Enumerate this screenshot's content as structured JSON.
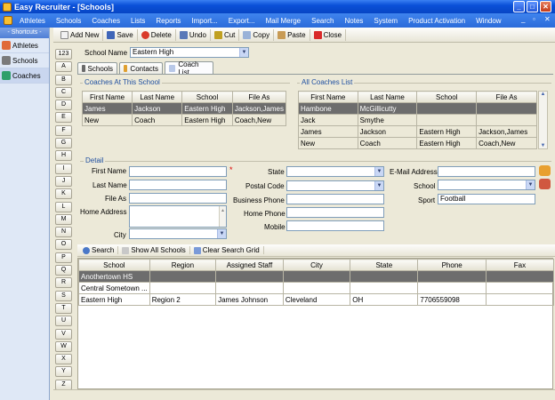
{
  "app": {
    "title": "Easy Recruiter - [Schools]"
  },
  "menu": [
    "Athletes",
    "Schools",
    "Coaches",
    "Lists",
    "Reports",
    "Import...",
    "Export...",
    "Mail Merge",
    "Search",
    "Notes",
    "System",
    "Product Activation",
    "Window"
  ],
  "shortcuts": {
    "header": "- Shortcuts -",
    "items": [
      "Athletes",
      "Schools",
      "Coaches"
    ]
  },
  "toolbar": {
    "add_new": "Add New",
    "save": "Save",
    "delete": "Delete",
    "undo": "Undo",
    "cut": "Cut",
    "copy": "Copy",
    "paste": "Paste",
    "close": "Close"
  },
  "alpha": [
    "123",
    "A",
    "B",
    "C",
    "D",
    "E",
    "F",
    "G",
    "H",
    "I",
    "J",
    "K",
    "L",
    "M",
    "N",
    "O",
    "P",
    "Q",
    "R",
    "S",
    "T",
    "U",
    "V",
    "W",
    "X",
    "Y",
    "Z"
  ],
  "school": {
    "label": "School Name",
    "value": "Eastern High"
  },
  "tabs": [
    "Schools",
    "Contacts",
    "Coach List"
  ],
  "coaches_at_school": {
    "title": "Coaches At This School",
    "headers": [
      "First Name",
      "Last Name",
      "School",
      "File As"
    ],
    "rows": [
      [
        "James",
        "Jackson",
        "Eastern High",
        "Jackson,James"
      ],
      [
        "New",
        "Coach",
        "Eastern High",
        "Coach,New"
      ]
    ]
  },
  "all_coaches": {
    "title": "All Coaches List",
    "headers": [
      "First Name",
      "Last Name",
      "School",
      "File As"
    ],
    "rows": [
      [
        "Hambone",
        "McGillicutty",
        "",
        ""
      ],
      [
        "Jack",
        "Smythe",
        "",
        ""
      ],
      [
        "James",
        "Jackson",
        "Eastern High",
        "Jackson,James"
      ],
      [
        "New",
        "Coach",
        "Eastern High",
        "Coach,New"
      ]
    ]
  },
  "detail": {
    "title": "Detail",
    "first_name": "First Name",
    "last_name": "Last Name",
    "file_as": "File As",
    "home_address": "Home Address",
    "city": "City",
    "state": "State",
    "postal_code": "Postal Code",
    "business_phone": "Business Phone",
    "home_phone": "Home Phone",
    "mobile": "Mobile",
    "email": "E-Mail Address",
    "school": "School",
    "sport": "Sport",
    "sport_value": "Football",
    "required_mark": "*"
  },
  "grid_buttons": {
    "search": "Search",
    "show_all": "Show All Schools",
    "clear": "Clear Search Grid"
  },
  "school_grid": {
    "headers": [
      "School",
      "Region",
      "Assigned Staff",
      "City",
      "State",
      "Phone",
      "Fax"
    ],
    "rows": [
      [
        "Anothertown HS",
        "",
        "",
        "",
        "",
        "",
        ""
      ],
      [
        "Central Sometown ...",
        "",
        "",
        "",
        "",
        "",
        ""
      ],
      [
        "Eastern High",
        "Region 2",
        "James Johnson",
        "Cleveland",
        "OH",
        "7706559098",
        ""
      ]
    ]
  },
  "colors": {
    "accent": "#0a50d8",
    "selected_row": "#6d6d6d"
  }
}
